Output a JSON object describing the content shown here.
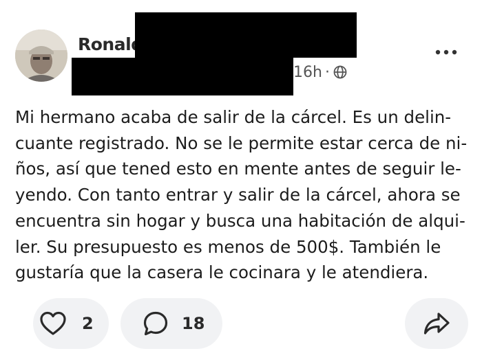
{
  "post": {
    "author_name": "Ronald",
    "time_ago": "16h",
    "separator": "·",
    "visibility_icon": "globe-icon",
    "menu_icon": "more-options-icon",
    "body_lines": [
      "Mi hermano acaba de salir de la cárcel. Es un delin-",
      "cuante registrado. No se le permite estar cerca de ni-",
      "ños, así que tened esto en mente antes de seguir le-",
      "yendo. Con tanto entrar y salir de la cárcel, ahora se",
      "encuentra sin hogar y busca una habitación de alqui-",
      "ler. Su presupuesto es menos de 500$. También le",
      "gustaría que la casera le cocinara y le atendiera."
    ]
  },
  "actions": {
    "like_count": "2",
    "comment_count": "18",
    "like_icon": "heart-icon",
    "comment_icon": "comment-bubble-icon",
    "share_icon": "share-arrow-icon"
  },
  "colors": {
    "pill_background": "#f1f2f4",
    "text": "#1c1c1c",
    "redaction": "#000000"
  }
}
